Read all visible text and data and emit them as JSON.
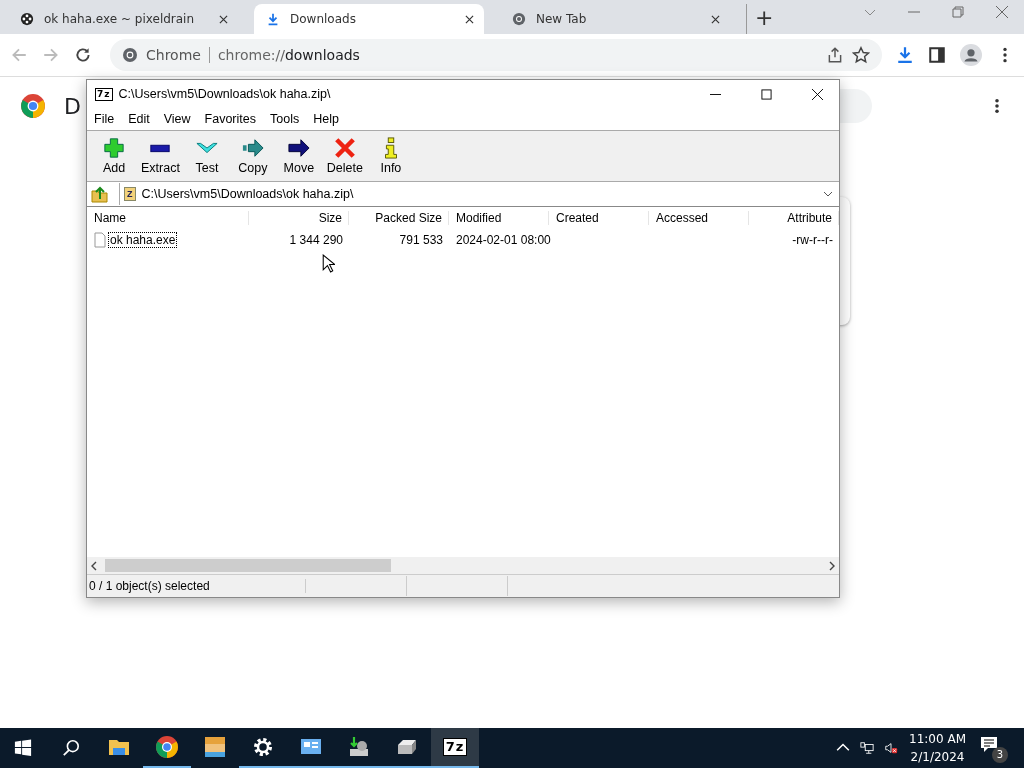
{
  "browser": {
    "tabs": [
      {
        "label": "ok haha.exe ~ pixeldrain",
        "selected": false
      },
      {
        "label": "Downloads",
        "selected": true
      },
      {
        "label": "New Tab",
        "selected": false
      }
    ],
    "new_tab": "+",
    "omnibox": {
      "site": "Chrome",
      "url_prefix": "chrome://",
      "url_host": "downloads"
    },
    "page": {
      "heading": "D"
    }
  },
  "window": {
    "logo": "7z",
    "title": "C:\\Users\\vm5\\Downloads\\ok haha.zip\\",
    "menu": [
      "File",
      "Edit",
      "View",
      "Favorites",
      "Tools",
      "Help"
    ],
    "toolbar": [
      {
        "label": "Add",
        "kind": "add"
      },
      {
        "label": "Extract",
        "kind": "extract"
      },
      {
        "label": "Test",
        "kind": "test"
      },
      {
        "label": "Copy",
        "kind": "copy"
      },
      {
        "label": "Move",
        "kind": "move"
      },
      {
        "label": "Delete",
        "kind": "delete"
      },
      {
        "label": "Info",
        "kind": "info"
      }
    ],
    "address": {
      "logo": "Z",
      "path": "C:\\Users\\vm5\\Downloads\\ok haha.zip\\"
    },
    "table": {
      "columns": [
        "Name",
        "Size",
        "Packed Size",
        "Modified",
        "Created",
        "Accessed",
        "Attribute"
      ],
      "rows": [
        {
          "cells": [
            "ok haha.exe",
            "1 344 290",
            "791 533",
            "2024-02-01 08:00",
            "",
            "",
            "-rw-r--r-"
          ],
          "focused": true
        }
      ]
    },
    "status_bar": "0 / 1 object(s) selected"
  },
  "taskbar": {
    "apps": [
      {
        "kind": "explorer",
        "running": false,
        "selected": false
      },
      {
        "kind": "chrome",
        "running": true,
        "selected": false
      },
      {
        "kind": "game",
        "running": false,
        "selected": false
      },
      {
        "kind": "settings",
        "running": true,
        "selected": false
      },
      {
        "kind": "monitor",
        "running": true,
        "selected": false
      },
      {
        "kind": "installer",
        "running": true,
        "selected": false
      },
      {
        "kind": "drive",
        "running": true,
        "selected": false
      },
      {
        "kind": "sevenzip",
        "running": true,
        "selected": true,
        "logo": "7z"
      }
    ],
    "time": "11:00 AM",
    "date": "2/1/2024",
    "notifications": "3"
  }
}
